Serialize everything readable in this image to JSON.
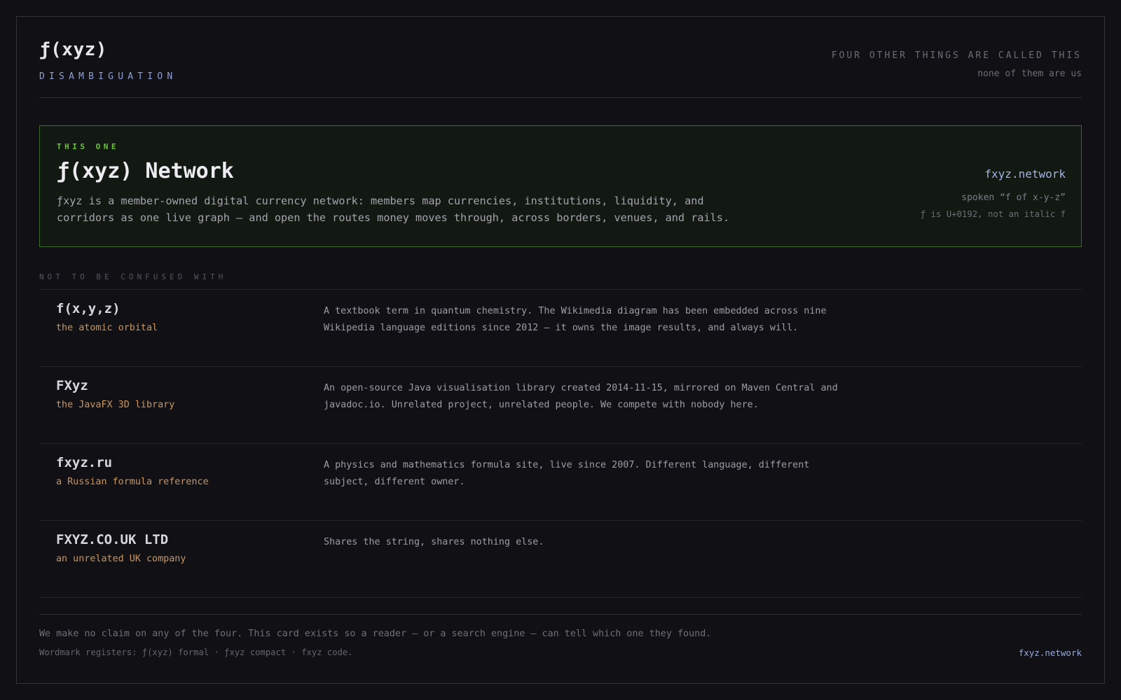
{
  "header": {
    "brand": "ƒ(xyz)",
    "subtitle": "DISAMBIGUATION",
    "note": "FOUR OTHER THINGS ARE CALLED THIS",
    "note_sub": "none of them are us"
  },
  "featured": {
    "tag": "THIS ONE",
    "title": "ƒ(xyz) Network",
    "description": "ƒxyz is a member-owned digital currency network: members map currencies, institutions, liquidity, and corridors as one live graph — and open the routes money moves through, across borders, venues, and rails.",
    "link": "fxyz.network",
    "spoken": "spoken “f of x-y-z”",
    "codepoint": "ƒ is U+0192, not an italic f"
  },
  "section_label": "NOT TO BE CONFUSED WITH",
  "items": [
    {
      "name": "f(x,y,z)",
      "tagline": "the atomic orbital",
      "description": "A textbook term in quantum chemistry. The Wikimedia diagram has been embedded across nine Wikipedia language editions since 2012 — it owns the image results, and always will."
    },
    {
      "name": "FXyz",
      "tagline": "the JavaFX 3D library",
      "description": "An open-source Java visualisation library created 2014-11-15, mirrored on Maven Central and javadoc.io. Unrelated project, unrelated people. We compete with nobody here."
    },
    {
      "name": "fxyz.ru",
      "tagline": "a Russian formula reference",
      "description": "A physics and mathematics formula site, live since 2007. Different language, different subject, different owner."
    },
    {
      "name": "FXYZ.CO.UK LTD",
      "tagline": "an unrelated UK company",
      "description": "Shares the string, shares nothing else."
    }
  ],
  "footer": {
    "claim": "We make no claim on any of the four. This card exists so a reader — or a search engine — can tell which one they found.",
    "wordmark": "Wordmark registers: ƒ(xyz) formal · ƒxyz compact · fxyz code.",
    "link": "fxyz.network"
  },
  "colors": {
    "background": "#101015",
    "accent_green": "#6ec23c",
    "accent_blue": "#8f9fd6",
    "accent_orange": "#c89763"
  }
}
